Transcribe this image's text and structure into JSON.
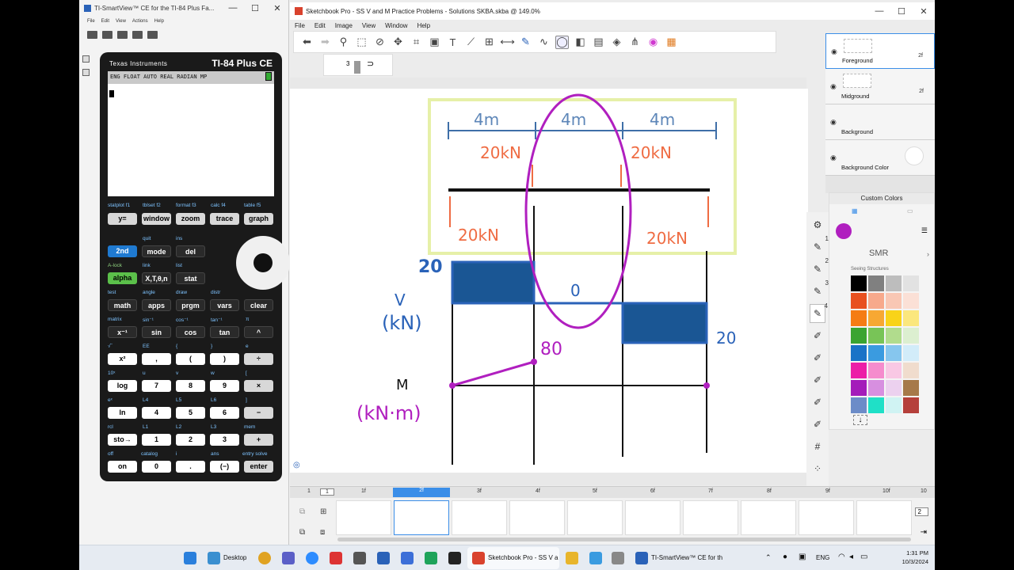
{
  "ti": {
    "title": "TI-SmartView™ CE for the TI-84 Plus Fa...",
    "menu": [
      "File",
      "Edit",
      "View",
      "Actions",
      "Help"
    ],
    "brand": "Texas Instruments",
    "model": "TI-84 Plus CE",
    "status": "ENG FLOAT AUTO REAL RADIAN MP",
    "fkey_subs": [
      "statplot f1",
      "tblset f2",
      "format f3",
      "calc f4",
      "table f5"
    ],
    "keys": {
      "y": "y=",
      "window": "window",
      "zoom": "zoom",
      "trace": "trace",
      "graph": "graph",
      "second": "2nd",
      "mode": "mode",
      "del": "del",
      "alpha": "alpha",
      "xt": "X,T,θ,n",
      "stat": "stat",
      "math": "math",
      "apps": "apps",
      "prgm": "prgm",
      "vars": "vars",
      "clear": "clear",
      "xinv": "x⁻¹",
      "sin": "sin",
      "cos": "cos",
      "tan": "tan",
      "caret": "^",
      "x2": "x²",
      "comma": ",",
      "lparen": "(",
      "rparen": ")",
      "div": "÷",
      "log": "log",
      "k7": "7",
      "k8": "8",
      "k9": "9",
      "mul": "×",
      "ln": "ln",
      "k4": "4",
      "k5": "5",
      "k6": "6",
      "minus": "−",
      "sto": "sto→",
      "k1": "1",
      "k2": "2",
      "k3": "3",
      "plus": "+",
      "on": "on",
      "k0": "0",
      "dot": ".",
      "neg": "(−)",
      "enter": "enter"
    },
    "subs": {
      "quit": "quit",
      "ins": "ins",
      "alock": "A-lock",
      "link": "link",
      "list": "list",
      "test": "test",
      "angle": "angle",
      "draw": "draw",
      "distr": "distr",
      "matrix": "matrix",
      "sin1": "sin⁻¹",
      "cos1": "cos⁻¹",
      "tan1": "tan⁻¹",
      "pi": "π",
      "sqrt": "√‾",
      "ee": "EE",
      "lbrace": "{",
      "rbrace": "}",
      "e": "e",
      "tenx": "10ˣ",
      "u": "u",
      "v": "v",
      "w": "w",
      "lbr": "[",
      "ex": "eˣ",
      "l4": "L4",
      "l5": "L5",
      "l6": "L6",
      "rbr": "]",
      "rcl": "rcl",
      "l1": "L1",
      "l2": "L2",
      "l3": "L3",
      "mem": "mem",
      "off": "off",
      "catalog": "catalog",
      "i": "i",
      "ans": "ans",
      "entry": "entry solve"
    }
  },
  "sketchbook": {
    "title": "Sketchbook Pro - SS V and M Practice Problems - Solutions SKBA.skba @ 149.0%",
    "menu": [
      "File",
      "Edit",
      "Image",
      "View",
      "Window",
      "Help"
    ],
    "brush_size": "3",
    "layers": [
      {
        "name": "Foreground",
        "frame": "2f"
      },
      {
        "name": "Midground",
        "frame": "2f"
      },
      {
        "name": "Background",
        "frame": ""
      },
      {
        "name": "Background Color",
        "frame": ""
      }
    ],
    "colors": {
      "header": "Custom Colors",
      "set_name": "SMR",
      "set_sub": "Seeing Structures",
      "current": "#b01fbf",
      "swatches": [
        [
          "#000000",
          "#808080",
          "#bdbdbd",
          "#e2e2e2"
        ],
        [
          "#e8501f",
          "#f7a98c",
          "#f9c7b4",
          "#fbe0d6"
        ],
        [
          "#f57c14",
          "#f7a833",
          "#f9d319",
          "#fbe77d"
        ],
        [
          "#3aa431",
          "#78c457",
          "#b1dc8d",
          "#dcefd0"
        ],
        [
          "#1a73c7",
          "#3a9be0",
          "#86c6ee",
          "#d2ecf9"
        ],
        [
          "#ec1ea7",
          "#f58ccd",
          "#f9c8e4",
          "#f0dccd"
        ],
        [
          "#a41cba",
          "#d78fe0",
          "#ecd1ef",
          "#a6794a"
        ],
        [
          "#6c8cc8",
          "#1fe0c7",
          "#d0f3f3",
          "#b5403b"
        ]
      ]
    },
    "brush_numbers": [
      "1",
      "2",
      "3",
      "4"
    ],
    "drawing": {
      "dims": [
        "4m",
        "4m",
        "4m"
      ],
      "loads_top": [
        "20kN",
        "20kN"
      ],
      "reactions": [
        "20kN",
        "20kN"
      ],
      "v_label_1": "V",
      "v_label_2": "(kN)",
      "m_label_1": "M",
      "m_label_2": "(kN·m)",
      "v_left": "20",
      "v_mid": "0",
      "v_right": "20",
      "m_val": "80"
    },
    "timeline": {
      "frame_start": "1",
      "frame_start2": "1",
      "frames": [
        "1f",
        "2f",
        "3f",
        "4f",
        "5f",
        "6f",
        "7f",
        "8f",
        "9f",
        "10f"
      ],
      "frame_end": "10",
      "zoom": "2"
    }
  },
  "taskbar": {
    "desktop": "Desktop",
    "sketchbook": "Sketchbook Pro - SS V a",
    "ti": "TI-SmartView™ CE for th",
    "lang": "ENG",
    "time": "1:31 PM",
    "date": "10/3/2024"
  }
}
